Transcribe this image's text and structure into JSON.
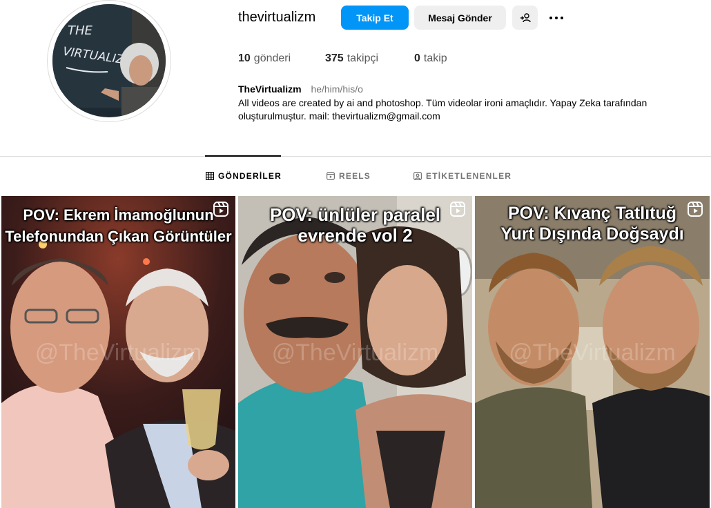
{
  "profile": {
    "username": "thevirtualizm",
    "display_name": "TheVirtualizm",
    "pronouns": "he/him/his/o",
    "bio_line1": "All videos are created by ai and photoshop. Tüm videolar ironi amaçlıdır. Yapay Zeka tarafından",
    "bio_line2": "oluşturulmuştur. mail: thevirtualizm@gmail.com",
    "avatar_chalk_text_1": "THE",
    "avatar_chalk_text_2": "VIRTUALIZM"
  },
  "actions": {
    "follow_label": "Takip Et",
    "message_label": "Mesaj Gönder"
  },
  "stats": {
    "posts_count": "10",
    "posts_label": "gönderi",
    "followers_count": "375",
    "followers_label": "takipçi",
    "following_count": "0",
    "following_label": "takip"
  },
  "tabs": [
    {
      "label": "GÖNDERİLER",
      "icon": "grid-icon",
      "active": true
    },
    {
      "label": "REELS",
      "icon": "reels-icon",
      "active": false
    },
    {
      "label": "ETİKETLENENLER",
      "icon": "tagged-icon",
      "active": false
    }
  ],
  "posts": [
    {
      "caption_line1": "POV: Ekrem İmamoğlunun",
      "caption_line2": "Telefonundan Çıkan Görüntüler",
      "watermark": "@TheVirtualizm",
      "type_icon": "reel-icon"
    },
    {
      "caption_line1": "POV: ünlüler paralel",
      "caption_line2": "evrende vol 2",
      "watermark": "@TheVirtualizm",
      "type_icon": "reel-icon"
    },
    {
      "caption_line1": "POV: Kıvanç Tatlıtuğ",
      "caption_line2": "Yurt Dışında Doğsaydı",
      "watermark": "@TheVirtualizm",
      "type_icon": "reel-icon"
    }
  ],
  "colors": {
    "primary_button": "#0095f6",
    "secondary_button": "#efefef",
    "muted_text": "#737373",
    "divider": "#dbdbdb"
  }
}
